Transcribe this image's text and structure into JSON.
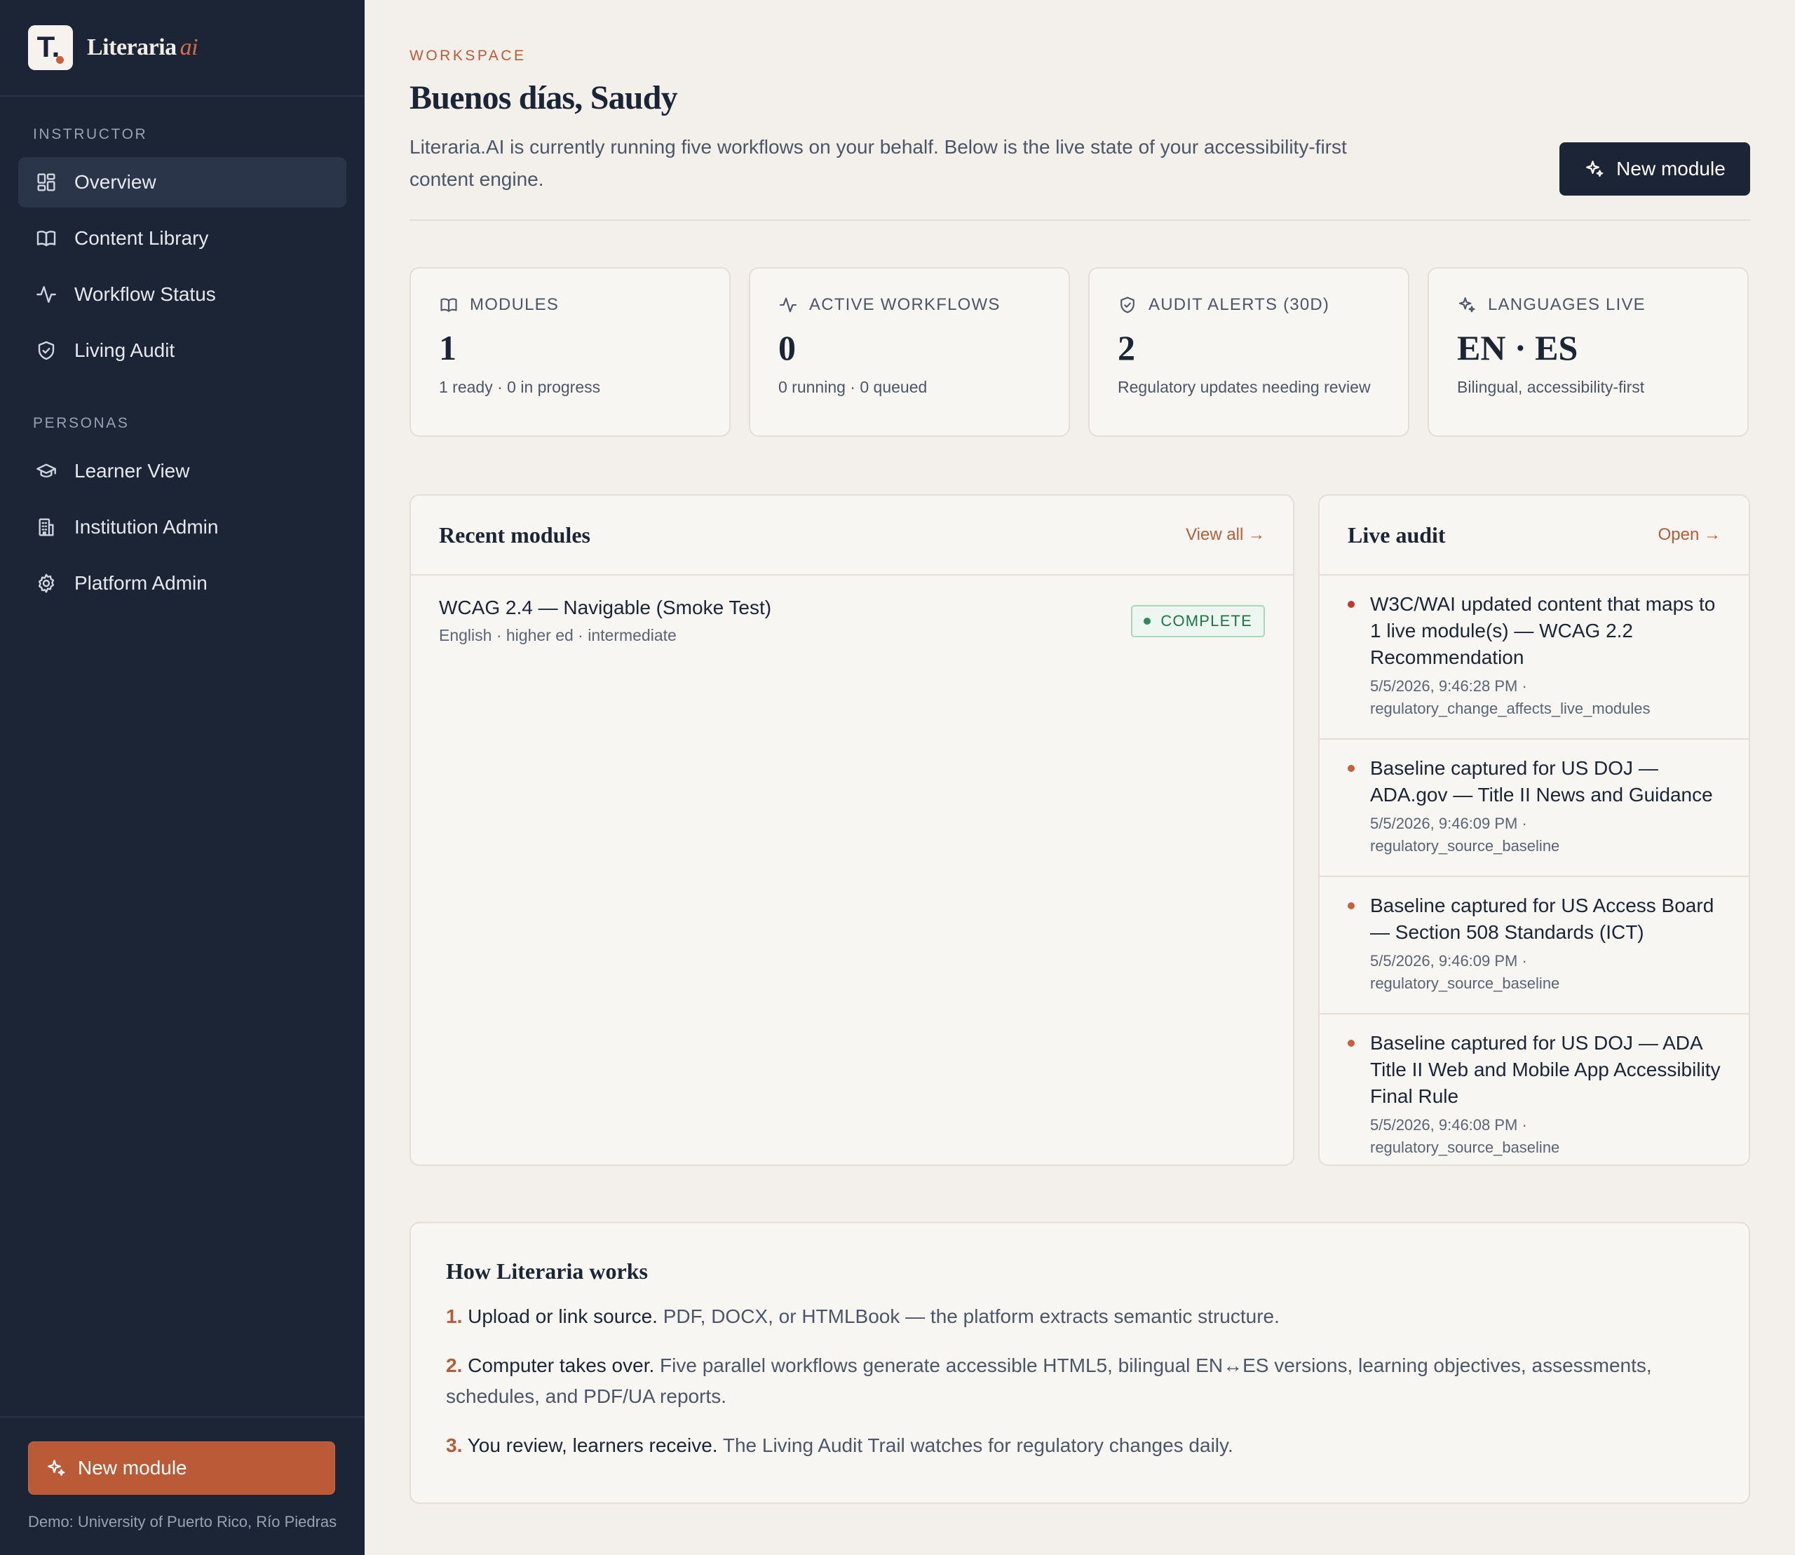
{
  "brand": {
    "logo_letter": "T.",
    "name": "Literaria",
    "suffix": "ai"
  },
  "sidebar": {
    "sections": [
      {
        "heading": "INSTRUCTOR",
        "items": [
          {
            "label": "Overview",
            "icon": "grid-icon",
            "active": true
          },
          {
            "label": "Content Library",
            "icon": "book-icon"
          },
          {
            "label": "Workflow Status",
            "icon": "activity-icon"
          },
          {
            "label": "Living Audit",
            "icon": "shield-check-icon"
          }
        ]
      },
      {
        "heading": "PERSONAS",
        "items": [
          {
            "label": "Learner View",
            "icon": "graduation-cap-icon"
          },
          {
            "label": "Institution Admin",
            "icon": "building-icon"
          },
          {
            "label": "Platform Admin",
            "icon": "gear-icon"
          }
        ]
      }
    ],
    "new_module_label": "New module",
    "demo_text": "Demo: University of Puerto Rico, Río Piedras"
  },
  "header": {
    "eyebrow": "WORKSPACE",
    "title": "Buenos días, Saudy",
    "intro": "Literaria.AI is currently running five workflows on your behalf. Below is the live state of your accessibility-first content engine.",
    "new_module_label": "New module"
  },
  "stats": [
    {
      "label": "MODULES",
      "icon": "book-icon",
      "value": "1",
      "sub": "1 ready · 0 in progress"
    },
    {
      "label": "ACTIVE WORKFLOWS",
      "icon": "activity-icon",
      "value": "0",
      "sub": "0 running · 0 queued"
    },
    {
      "label": "AUDIT ALERTS (30D)",
      "icon": "shield-check-icon",
      "value": "2",
      "sub": "Regulatory updates needing review"
    },
    {
      "label": "LANGUAGES LIVE",
      "icon": "sparkle-icon",
      "value": "EN · ES",
      "sub": "Bilingual, accessibility-first"
    }
  ],
  "recent_modules": {
    "title": "Recent modules",
    "link": "View all →",
    "items": [
      {
        "title": "WCAG 2.4 — Navigable (Smoke Test)",
        "meta": "English · higher ed · intermediate",
        "status": "COMPLETE"
      }
    ]
  },
  "live_audit": {
    "title": "Live audit",
    "link": "Open →",
    "items": [
      {
        "title": "W3C/WAI updated content that maps to 1 live module(s) — WCAG 2.2 Recommendation",
        "meta": "5/5/2026, 9:46:28 PM · regulatory_change_affects_live_modules",
        "dot_color": "#c0392b"
      },
      {
        "title": "Baseline captured for US DOJ — ADA.gov — Title II News and Guidance",
        "meta": "5/5/2026, 9:46:09 PM · regulatory_source_baseline",
        "dot_color": "#c8603c"
      },
      {
        "title": "Baseline captured for US Access Board — Section 508 Standards (ICT)",
        "meta": "5/5/2026, 9:46:09 PM · regulatory_source_baseline",
        "dot_color": "#c8603c"
      },
      {
        "title": "Baseline captured for US DOJ — ADA Title II Web and Mobile App Accessibility Final Rule",
        "meta": "5/5/2026, 9:46:08 PM · regulatory_source_baseline",
        "dot_color": "#c8603c"
      }
    ]
  },
  "how_it_works": {
    "title": "How Literaria works",
    "steps": [
      {
        "num": "1.",
        "lead": "Upload or link source.",
        "text": "PDF, DOCX, or HTMLBook — the platform extracts semantic structure."
      },
      {
        "num": "2.",
        "lead": "Computer takes over.",
        "text": "Five parallel workflows generate accessible HTML5, bilingual EN↔ES versions, learning objectives, assessments, schedules, and PDF/UA reports."
      },
      {
        "num": "3.",
        "lead": "You review, learners receive.",
        "text": "The Living Audit Trail watches for regulatory changes daily."
      }
    ]
  },
  "colors": {
    "accent": "#bb5a36",
    "sidebar_bg": "#1b2535",
    "page_bg": "#f3efea",
    "success": "#1d7448"
  }
}
